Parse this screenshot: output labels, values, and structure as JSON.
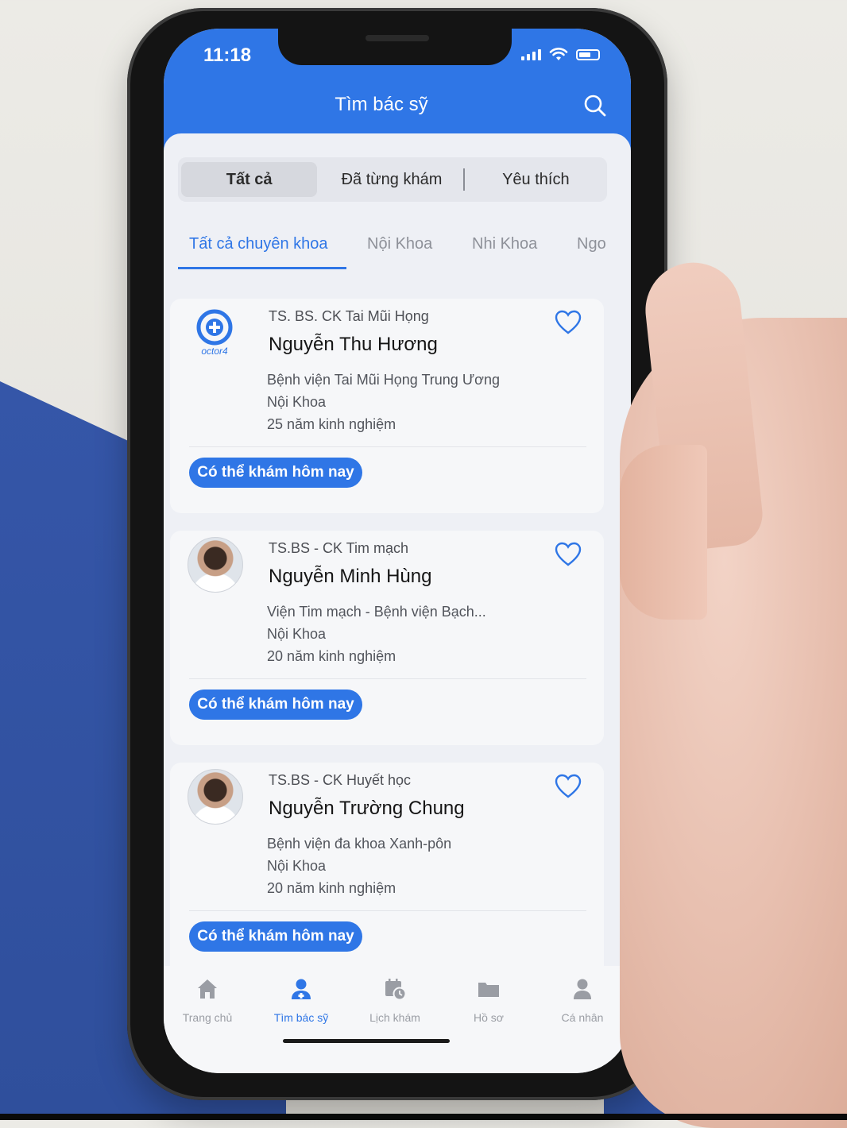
{
  "status": {
    "time": "11:18"
  },
  "header": {
    "title": "Tìm bác sỹ"
  },
  "segments": [
    "Tất cả",
    "Đã từng khám",
    "Yêu thích"
  ],
  "specialties": [
    "Tất cả chuyên khoa",
    "Nội Khoa",
    "Nhi Khoa",
    "Ngo"
  ],
  "doctors": [
    {
      "title": "TS. BS. CK Tai Mũi Họng",
      "name": "Nguyễn Thu Hương",
      "hospital": "Bệnh viện Tai Mũi Họng Trung Ương",
      "department": "Nội Khoa",
      "experience": "25 năm kinh nghiệm",
      "availability": "Có thể khám hôm nay",
      "logo_text": "octor4"
    },
    {
      "title": "TS.BS - CK Tim mạch",
      "name": "Nguyễn Minh Hùng",
      "hospital": "Viện Tim mạch - Bệnh viện Bạch...",
      "department": "Nội Khoa",
      "experience": "20 năm kinh nghiệm",
      "availability": "Có thể khám hôm nay"
    },
    {
      "title": "TS.BS - CK Huyết học",
      "name": "Nguyễn Trường Chung",
      "hospital": "Bệnh viện đa khoa Xanh-pôn",
      "department": "Nội Khoa",
      "experience": "20 năm kinh nghiệm",
      "availability": "Có thể khám hôm nay"
    }
  ],
  "bottom_nav": [
    "Trang chủ",
    "Tìm bác sỹ",
    "Lịch khám",
    "Hồ sơ",
    "Cá nhân"
  ],
  "colors": {
    "primary": "#2f76e6",
    "background": "#eef0f5"
  }
}
